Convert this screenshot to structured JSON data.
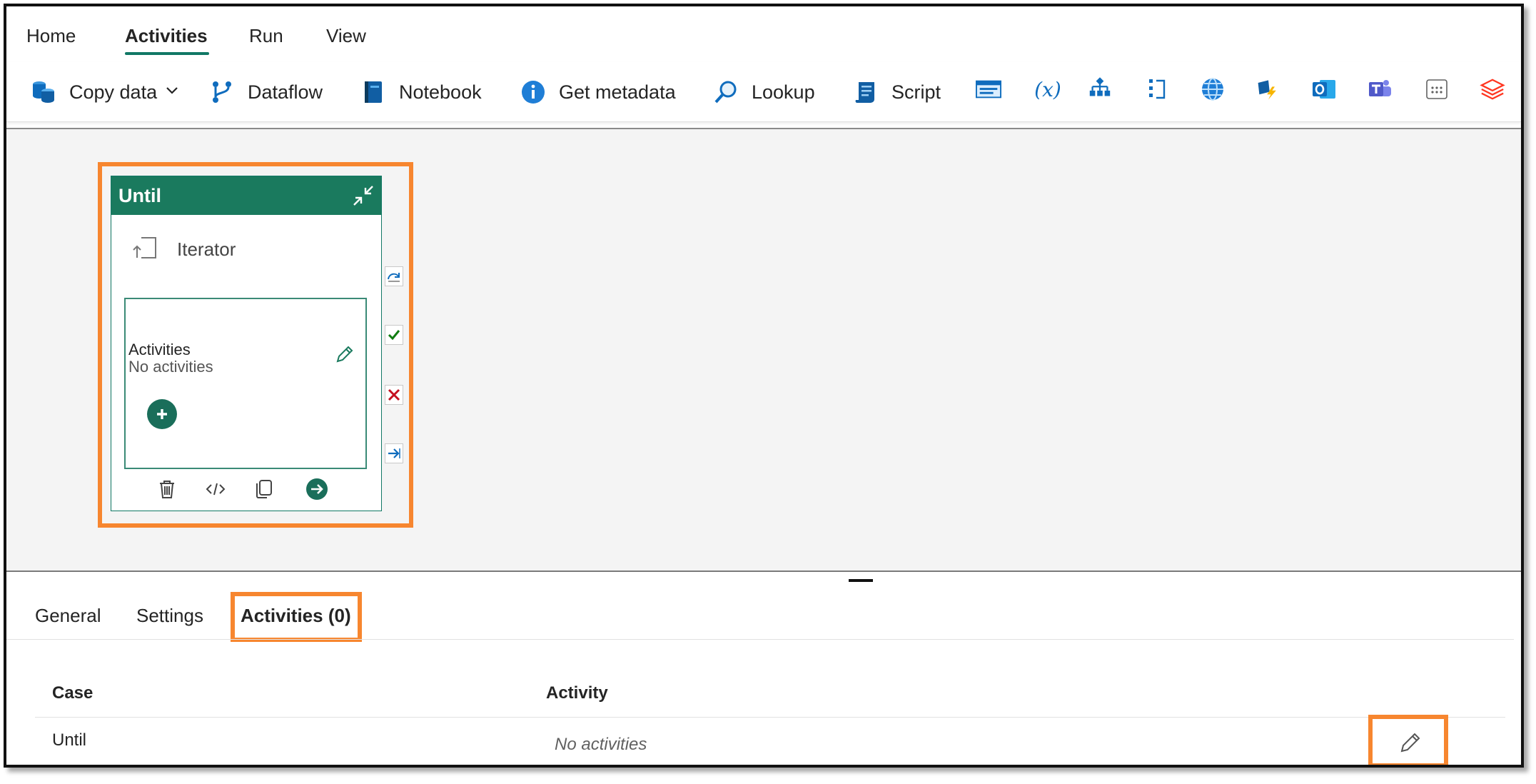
{
  "nav": {
    "tabs": [
      {
        "label": "Home"
      },
      {
        "label": "Activities"
      },
      {
        "label": "Run"
      },
      {
        "label": "View"
      }
    ],
    "active_tab": "Activities"
  },
  "toolbar": {
    "items": [
      {
        "label": "Copy data",
        "icon": "copy-data-icon",
        "has_dropdown": true
      },
      {
        "label": "Dataflow",
        "icon": "dataflow-icon"
      },
      {
        "label": "Notebook",
        "icon": "notebook-icon"
      },
      {
        "label": "Get metadata",
        "icon": "info-icon"
      },
      {
        "label": "Lookup",
        "icon": "lookup-icon"
      },
      {
        "label": "Script",
        "icon": "script-icon"
      }
    ],
    "icon_only": [
      "stored-procedure-icon",
      "variable-icon",
      "switch-icon",
      "until-icon",
      "web-icon",
      "azure-function-icon",
      "outlook-icon",
      "teams-icon",
      "more-icon",
      "databricks-icon"
    ],
    "variable_glyph": "(x)"
  },
  "canvas": {
    "until_card": {
      "title": "Until",
      "iterator_label": "Iterator",
      "activities_title": "Activities",
      "activities_status": "No activities"
    }
  },
  "bottom_panel": {
    "tabs": [
      {
        "label": "General"
      },
      {
        "label": "Settings"
      },
      {
        "label": "Activities (0)"
      }
    ],
    "active_tab": "Activities (0)",
    "table": {
      "columns": [
        "Case",
        "Activity"
      ],
      "rows": [
        {
          "case": "Until",
          "activity": "No activities"
        }
      ]
    }
  },
  "colors": {
    "accent": "#117865",
    "card_header": "#1a7a5e",
    "highlight": "#f7862f",
    "success": "#107c10",
    "failure": "#c50f1f",
    "info_blue": "#0f6cbd"
  }
}
